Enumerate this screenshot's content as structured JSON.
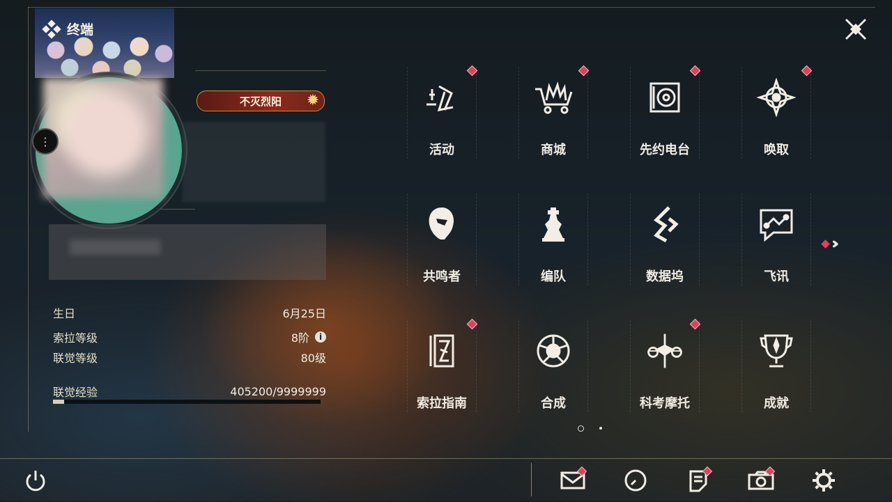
{
  "window": {
    "title": "终端"
  },
  "profile": {
    "title_badge": "不灭烈阳",
    "stats": [
      {
        "key": "生日",
        "value": "6月25日"
      },
      {
        "key": "索拉等级",
        "value": "8阶"
      },
      {
        "key": "联觉等级",
        "value": "80级"
      },
      {
        "key": "联觉经验",
        "value": "405200/9999999"
      }
    ],
    "exp_fraction": 0.0405,
    "info_icon": "i"
  },
  "menu": {
    "items": [
      {
        "label": "活动",
        "icon": "event-icon",
        "notify": true
      },
      {
        "label": "商城",
        "icon": "shop-icon",
        "notify": true
      },
      {
        "label": "先约电台",
        "icon": "radio-icon",
        "notify": true
      },
      {
        "label": "唤取",
        "icon": "convene-icon",
        "notify": true
      },
      {
        "label": "共鸣者",
        "icon": "resonator-icon",
        "notify": false
      },
      {
        "label": "编队",
        "icon": "team-icon",
        "notify": false
      },
      {
        "label": "数据坞",
        "icon": "databank-icon",
        "notify": false
      },
      {
        "label": "飞讯",
        "icon": "message-icon",
        "notify": false
      },
      {
        "label": "索拉指南",
        "icon": "guidebook-icon",
        "notify": true
      },
      {
        "label": "合成",
        "icon": "synthesis-icon",
        "notify": false
      },
      {
        "label": "科考摩托",
        "icon": "motorbike-icon",
        "notify": true
      },
      {
        "label": "成就",
        "icon": "trophy-icon",
        "notify": false
      }
    ],
    "page_current": 1,
    "page_total": 2
  },
  "bottom": {
    "buttons": [
      {
        "icon": "mail-icon",
        "notify": true
      },
      {
        "icon": "clock-icon",
        "notify": false
      },
      {
        "icon": "notes-icon",
        "notify": true
      },
      {
        "icon": "camera-icon",
        "notify": true
      },
      {
        "icon": "gear-icon",
        "notify": false
      }
    ]
  },
  "colors": {
    "notify": "#e0415a",
    "text": "#f0ece3",
    "accent_gold": "#c9903a"
  }
}
